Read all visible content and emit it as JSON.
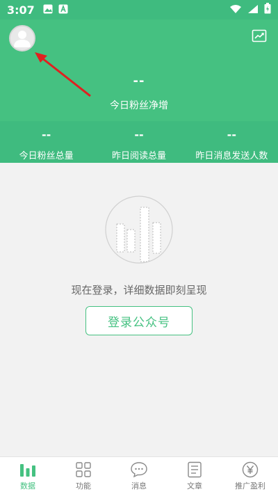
{
  "status_bar": {
    "time": "3:07"
  },
  "header": {
    "main_value": "--",
    "main_label": "今日粉丝净增",
    "stats": [
      {
        "value": "--",
        "label": "今日粉丝总量"
      },
      {
        "value": "--",
        "label": "昨日阅读总量"
      },
      {
        "value": "--",
        "label": "昨日消息发送人数"
      }
    ]
  },
  "empty_state": {
    "message": "现在登录，详细数据即刻呈现",
    "login_label": "登录公众号"
  },
  "nav": {
    "items": [
      {
        "label": "数据",
        "icon": "bar-chart-icon",
        "active": true
      },
      {
        "label": "功能",
        "icon": "grid-icon",
        "active": false
      },
      {
        "label": "消息",
        "icon": "chat-bubble-icon",
        "active": false
      },
      {
        "label": "文章",
        "icon": "document-icon",
        "active": false
      },
      {
        "label": "推广盈利",
        "icon": "yen-icon",
        "active": false
      }
    ]
  },
  "colors": {
    "accent": "#45c181",
    "accent_dark": "#3fbb7f",
    "annotation": "#e02020"
  }
}
